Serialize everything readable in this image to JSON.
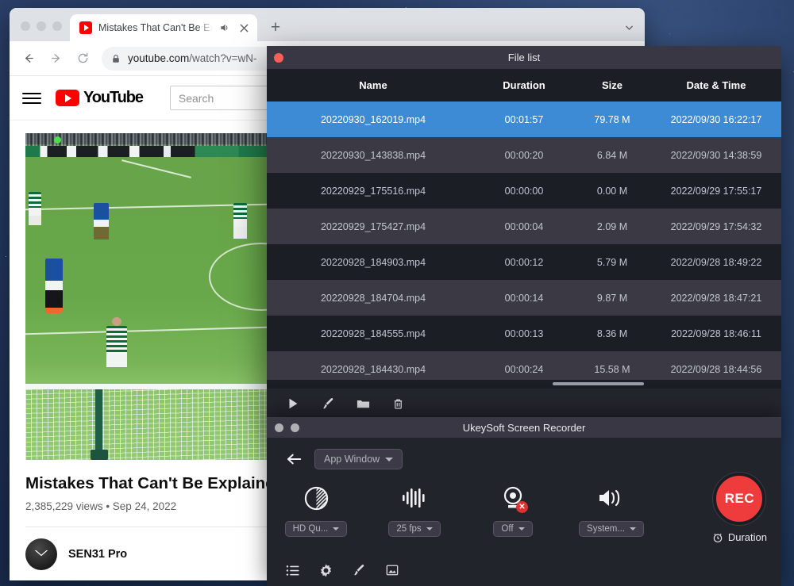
{
  "browser": {
    "tab": {
      "title": "Mistakes That Can't Be Exp",
      "favicon": "youtube-favicon",
      "audio_icon": "speaker-icon",
      "close_icon": "close-icon"
    },
    "new_tab_label": "+",
    "tab_list_icon": "chevron-down-icon",
    "nav": {
      "back_icon": "arrow-left-icon",
      "forward_icon": "arrow-right-icon",
      "reload_icon": "reload-icon"
    },
    "address": {
      "lock_icon": "lock-icon",
      "url_main": "youtube.com",
      "url_rest": "/watch?v=wN-"
    }
  },
  "youtube": {
    "menu_icon": "hamburger-icon",
    "logo_text": "YouTube",
    "search_placeholder": "Search",
    "video": {
      "title": "Mistakes That Can't Be Explained",
      "meta": "2,385,229 views • Sep 24, 2022",
      "channel": "SEN31 Pro"
    }
  },
  "file_list": {
    "window_title": "File list",
    "close_icon": "close-icon",
    "columns": [
      "Name",
      "Duration",
      "Size",
      "Date & Time"
    ],
    "selected_index": 0,
    "selection_color": "#3d8bd4",
    "rows": [
      {
        "name": "20220930_162019.mp4",
        "duration": "00:01:57",
        "size": "79.78 M",
        "date": "2022/09/30 16:22:17"
      },
      {
        "name": "20220930_143838.mp4",
        "duration": "00:00:20",
        "size": "6.84 M",
        "date": "2022/09/30 14:38:59"
      },
      {
        "name": "20220929_175516.mp4",
        "duration": "00:00:00",
        "size": "0.00 M",
        "date": "2022/09/29 17:55:17"
      },
      {
        "name": "20220929_175427.mp4",
        "duration": "00:00:04",
        "size": "2.09 M",
        "date": "2022/09/29 17:54:32"
      },
      {
        "name": "20220928_184903.mp4",
        "duration": "00:00:12",
        "size": "5.79 M",
        "date": "2022/09/28 18:49:22"
      },
      {
        "name": "20220928_184704.mp4",
        "duration": "00:00:14",
        "size": "9.87 M",
        "date": "2022/09/28 18:47:21"
      },
      {
        "name": "20220928_184555.mp4",
        "duration": "00:00:13",
        "size": "8.36 M",
        "date": "2022/09/28 18:46:11"
      },
      {
        "name": "20220928_184430.mp4",
        "duration": "00:00:24",
        "size": "15.58 M",
        "date": "2022/09/28 18:44:56"
      }
    ],
    "toolbar_icons": [
      "play-icon",
      "brush-icon",
      "folder-icon",
      "trash-icon"
    ]
  },
  "recorder": {
    "window_title": "UkeySoft Screen Recorder",
    "back_icon": "arrow-left-icon",
    "source_label": "App Window",
    "controls": [
      {
        "icon": "quality-icon",
        "value": "HD Qu..."
      },
      {
        "icon": "framerate-icon",
        "value": "25 fps"
      },
      {
        "icon": "webcam-off-icon",
        "value": "Off"
      },
      {
        "icon": "speaker-icon",
        "value": "System..."
      }
    ],
    "record_button": "REC",
    "record_color": "#ee3b3b",
    "duration_label": "Duration",
    "duration_icon": "alarm-clock-icon",
    "bottom_icons": [
      "list-icon",
      "settings-gear-icon",
      "brush-icon",
      "screenshot-icon"
    ]
  }
}
